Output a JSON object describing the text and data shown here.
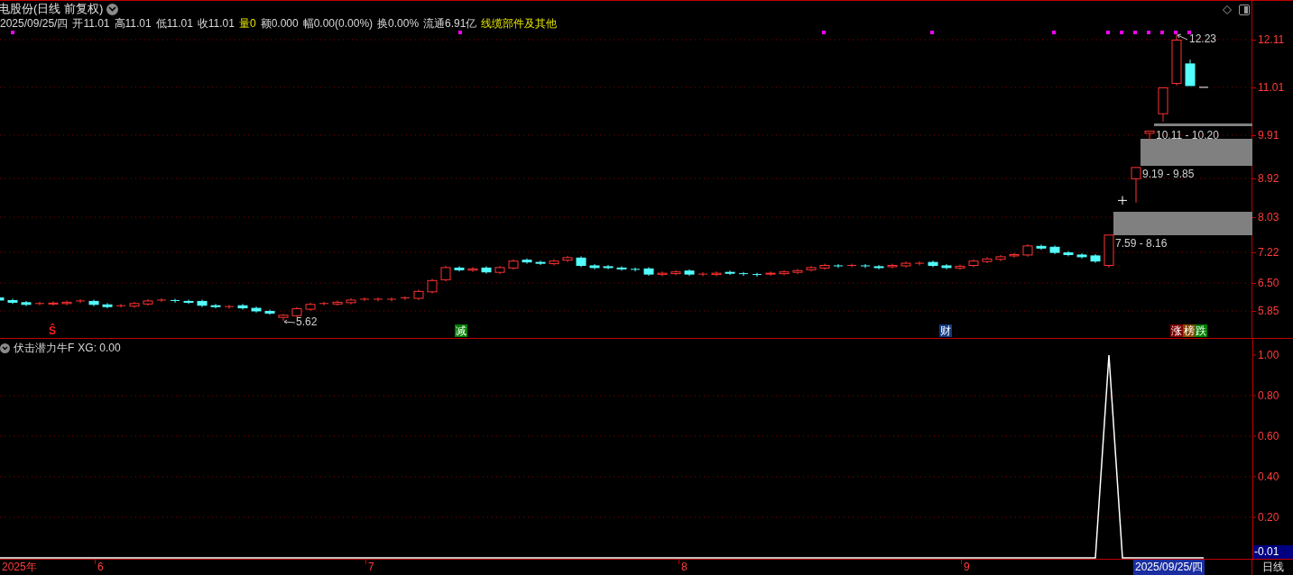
{
  "header": {
    "title": "电股份(日线 前复权)",
    "info": [
      {
        "text": "2025/09/25/四",
        "highlight": false
      },
      {
        "text": "开11.01",
        "highlight": false
      },
      {
        "text": "高11.01",
        "highlight": false
      },
      {
        "text": "低11.01",
        "highlight": false
      },
      {
        "text": "收11.01",
        "highlight": false
      },
      {
        "text": "量0",
        "highlight": true
      },
      {
        "text": "额0.000",
        "highlight": false
      },
      {
        "text": "幅0.00(0.00%)",
        "highlight": false
      },
      {
        "text": "换0.00%",
        "highlight": false
      },
      {
        "text": "流通6.91亿",
        "highlight": false
      },
      {
        "text": "线缆部件及其他",
        "highlight": true
      }
    ]
  },
  "price_axis": {
    "ticks": [
      "12.11",
      "11.01",
      "9.91",
      "8.92",
      "8.03",
      "7.22",
      "6.50",
      "5.85"
    ]
  },
  "price_labels": [
    {
      "text": "12.23"
    },
    {
      "text": "5.62"
    }
  ],
  "zones": [
    {
      "label": "10.11 - 10.20"
    },
    {
      "label": "9.19 - 9.85"
    },
    {
      "label": "7.59 - 8.16"
    }
  ],
  "event_markers": [
    {
      "text": "Ŝ",
      "kind": "plain",
      "color": "#ff2020"
    },
    {
      "text": "减",
      "kind": "badge",
      "color": "#008000"
    },
    {
      "text": "财",
      "kind": "badge",
      "color": "#123a80"
    },
    {
      "text": "涨",
      "kind": "badge",
      "color": "#800000"
    },
    {
      "text": "榜",
      "kind": "badge",
      "color": "#8b4a00"
    },
    {
      "text": "跌",
      "kind": "badge",
      "color": "#008000"
    }
  ],
  "indicator": {
    "title": "伏击潜力牛F",
    "reading": "XG: 0.00",
    "value_tag": "-0.01",
    "chart_data": {
      "type": "line",
      "grid": true,
      "ylim": [
        0,
        1.08
      ],
      "yticks": [
        {
          "value": 1,
          "label": "1.00"
        },
        {
          "value": 0.8,
          "label": "0.80"
        },
        {
          "value": 0.6,
          "label": "0.60"
        },
        {
          "value": 0.4,
          "label": "0.40"
        },
        {
          "value": 0.2,
          "label": "0.20"
        }
      ],
      "series": [
        {
          "color": "#ffffff",
          "values": [
            0,
            0,
            0,
            0,
            0,
            0,
            0,
            0,
            0,
            0,
            0,
            0,
            0,
            0,
            0,
            0,
            0,
            0,
            0,
            0,
            0,
            0,
            0,
            0,
            0,
            0,
            0,
            0,
            0,
            0,
            0,
            0,
            0,
            0,
            0,
            0,
            0,
            0,
            0,
            0,
            0,
            0,
            0,
            0,
            0,
            0,
            0,
            0,
            0,
            0,
            0,
            0,
            0,
            0,
            0,
            0,
            0,
            0,
            0,
            0,
            0,
            0,
            0,
            0,
            0,
            0,
            0,
            0,
            0,
            0,
            0,
            0,
            0,
            0,
            0,
            0,
            0,
            0,
            0,
            0,
            0,
            0,
            1,
            0,
            0,
            0,
            0,
            0,
            0,
            0
          ]
        }
      ]
    }
  },
  "time_axis": {
    "labels": [
      "2025年",
      "6",
      "7",
      "8",
      "9"
    ],
    "cursor_date": "2025/09/25/四",
    "period": "日线"
  }
}
